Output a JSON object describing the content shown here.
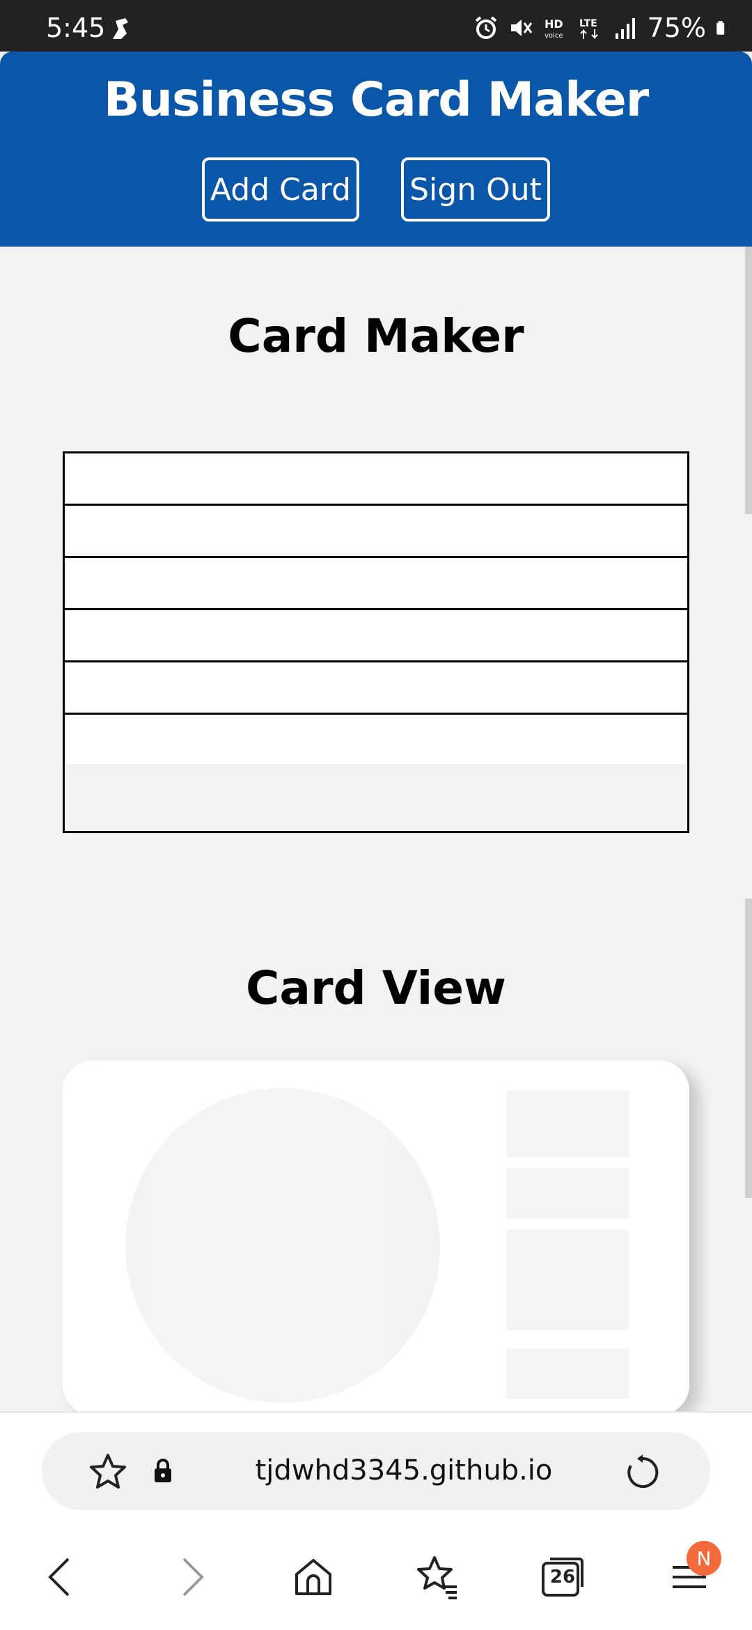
{
  "status_bar": {
    "time": "5:45",
    "battery": "75%",
    "icons": [
      "accessibility-icon",
      "alarm-icon",
      "mute-icon",
      "hd-voice-icon",
      "lte-icon",
      "signal-icon",
      "battery-icon"
    ]
  },
  "header": {
    "title": "Business Card Maker",
    "add_card_label": "Add Card",
    "sign_out_label": "Sign Out",
    "color": "#0a56a8"
  },
  "maker": {
    "title": "Card Maker",
    "rows": 6
  },
  "view": {
    "title": "Card View"
  },
  "browser": {
    "url": "tjdwhd3345.github.io",
    "tab_count": "26",
    "notification_badge": "N",
    "badge_color": "#f46a3a"
  }
}
